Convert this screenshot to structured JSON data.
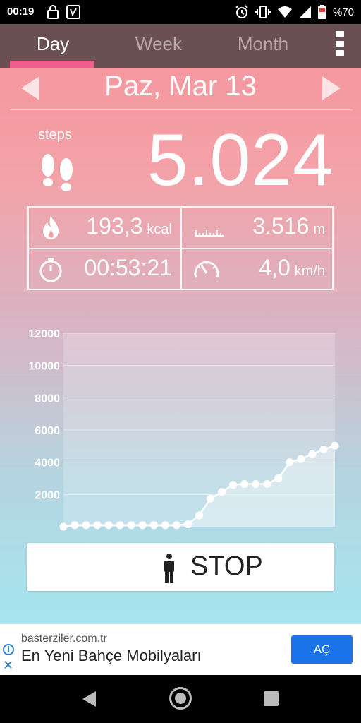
{
  "status": {
    "time": "00:19",
    "battery": "%70"
  },
  "tabs": {
    "day": "Day",
    "week": "Week",
    "month": "Month"
  },
  "date": {
    "label": "Paz, Mar 13"
  },
  "steps": {
    "label": "steps",
    "value": "5.024"
  },
  "stats": {
    "calories": {
      "value": "193,3",
      "unit": "kcal",
      "icon": "flame-icon"
    },
    "distance": {
      "value": "3.516",
      "unit": "m",
      "icon": "ruler-icon"
    },
    "duration": {
      "value": "00:53:21",
      "icon": "stopwatch-icon"
    },
    "speed": {
      "value": "4,0",
      "unit": "km/h",
      "icon": "speedometer-icon"
    }
  },
  "chart_data": {
    "type": "area",
    "x": [
      0,
      1,
      2,
      3,
      4,
      5,
      6,
      7,
      8,
      9,
      10,
      11,
      12,
      13,
      14,
      15,
      16,
      17,
      18,
      19,
      20,
      21,
      22,
      23,
      24
    ],
    "values": [
      0,
      100,
      100,
      100,
      100,
      100,
      100,
      100,
      100,
      100,
      100,
      150,
      700,
      1750,
      2150,
      2600,
      2650,
      2650,
      2650,
      3000,
      4000,
      4200,
      4500,
      4800,
      5024
    ],
    "xticks": [
      2,
      4,
      6,
      8,
      10,
      12,
      14,
      16,
      18,
      20,
      22,
      24
    ],
    "yticks": [
      2000,
      4000,
      6000,
      8000,
      10000,
      12000
    ],
    "xlim": [
      0,
      24
    ],
    "ylim": [
      0,
      12000
    ],
    "grid": true
  },
  "stop_button": {
    "label": "STOP"
  },
  "ad": {
    "domain": "basterziler.com.tr",
    "title": "En Yeni Bahçe Mobilyaları",
    "cta": "AÇ"
  }
}
